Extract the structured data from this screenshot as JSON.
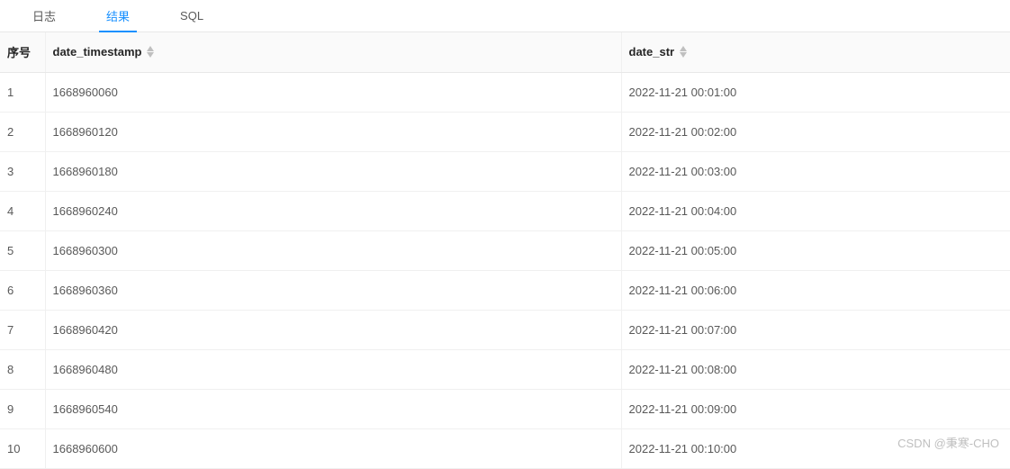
{
  "tabs": {
    "log": "日志",
    "result": "结果",
    "sql": "SQL",
    "active": "result"
  },
  "columns": {
    "seq": "序号",
    "date_timestamp": "date_timestamp",
    "date_str": "date_str"
  },
  "rows": [
    {
      "seq": "1",
      "date_timestamp": "1668960060",
      "date_str": "2022-11-21 00:01:00"
    },
    {
      "seq": "2",
      "date_timestamp": "1668960120",
      "date_str": "2022-11-21 00:02:00"
    },
    {
      "seq": "3",
      "date_timestamp": "1668960180",
      "date_str": "2022-11-21 00:03:00"
    },
    {
      "seq": "4",
      "date_timestamp": "1668960240",
      "date_str": "2022-11-21 00:04:00"
    },
    {
      "seq": "5",
      "date_timestamp": "1668960300",
      "date_str": "2022-11-21 00:05:00"
    },
    {
      "seq": "6",
      "date_timestamp": "1668960360",
      "date_str": "2022-11-21 00:06:00"
    },
    {
      "seq": "7",
      "date_timestamp": "1668960420",
      "date_str": "2022-11-21 00:07:00"
    },
    {
      "seq": "8",
      "date_timestamp": "1668960480",
      "date_str": "2022-11-21 00:08:00"
    },
    {
      "seq": "9",
      "date_timestamp": "1668960540",
      "date_str": "2022-11-21 00:09:00"
    },
    {
      "seq": "10",
      "date_timestamp": "1668960600",
      "date_str": "2022-11-21 00:10:00"
    }
  ],
  "watermark": "CSDN @秉寒-CHO"
}
